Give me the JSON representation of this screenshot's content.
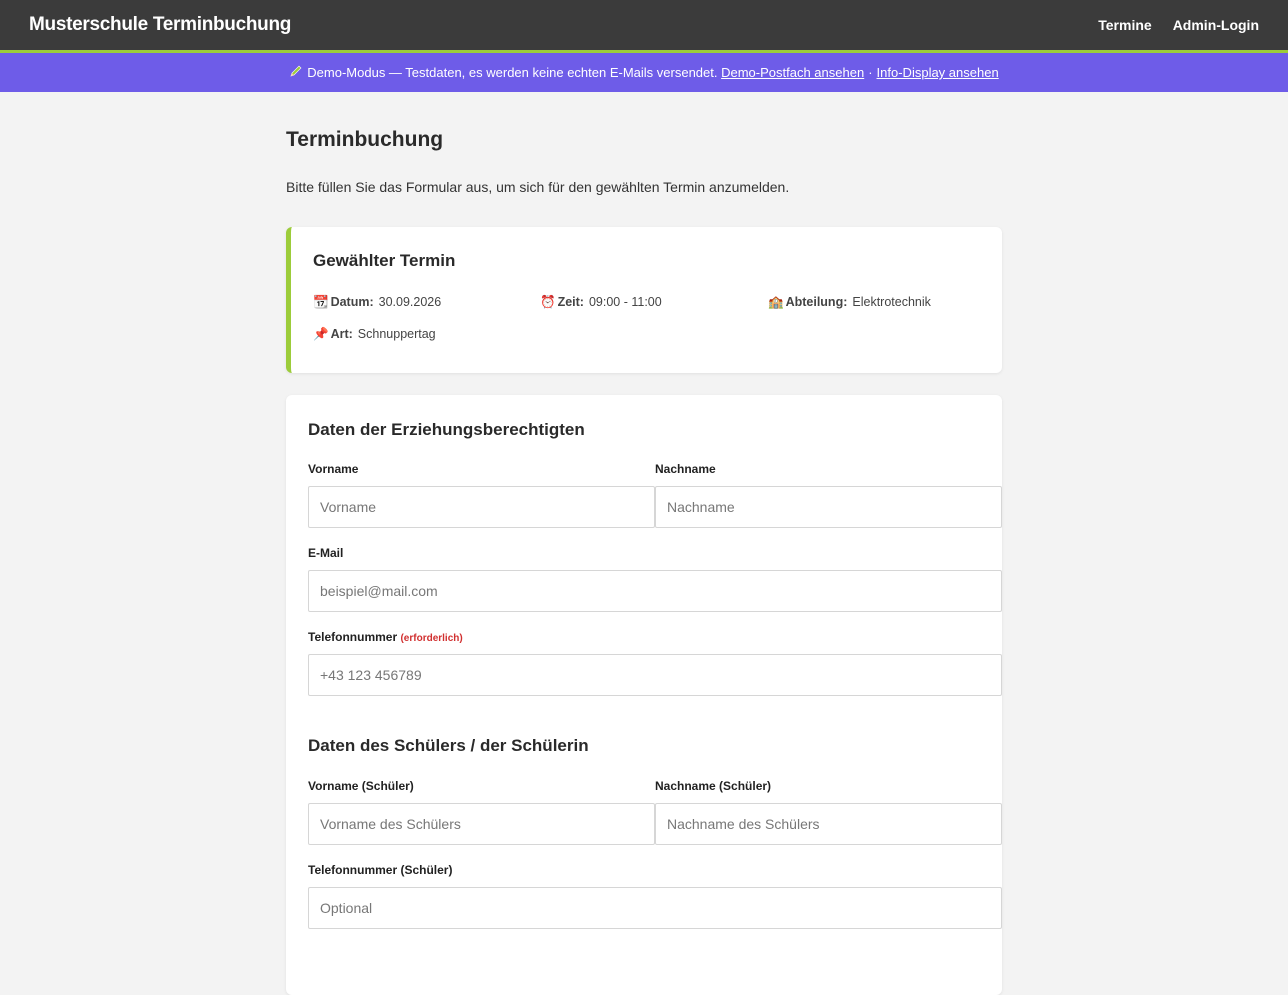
{
  "header": {
    "brand": "Musterschule Terminbuchung",
    "nav": [
      "Termine",
      "Admin-Login"
    ]
  },
  "banner": {
    "icon": "pencil-icon",
    "text": "Demo-Modus — Testdaten, es werden keine echten E-Mails versendet.",
    "link1": "Demo-Postfach ansehen",
    "separator": "·",
    "link2": "Info-Display ansehen"
  },
  "page": {
    "title": "Terminbuchung",
    "intro": "Bitte füllen Sie das Formular aus, um sich für den gewählten Termin anzumelden."
  },
  "termin": {
    "heading": "Gewählter Termin",
    "items": [
      {
        "icon": "📆",
        "label": "Datum:",
        "value": "30.09.2026"
      },
      {
        "icon": "⏰",
        "label": "Zeit:",
        "value": "09:00 - 11:00"
      },
      {
        "icon": "🏫",
        "label": "Abteilung:",
        "value": "Elektrotechnik"
      },
      {
        "icon": "📌",
        "label": "Art:",
        "value": "Schnuppertag"
      }
    ]
  },
  "guardian": {
    "heading": "Daten der Erziehungsberechtigten",
    "firstname": {
      "label": "Vorname",
      "placeholder": "Vorname",
      "value": ""
    },
    "lastname": {
      "label": "Nachname",
      "placeholder": "Nachname",
      "value": ""
    },
    "email": {
      "label": "E-Mail",
      "placeholder": "beispiel@mail.com",
      "value": ""
    },
    "phone": {
      "label": "Telefonnummer",
      "required_note": "(erforderlich)",
      "placeholder": "+43 123 456789",
      "value": ""
    }
  },
  "student": {
    "heading": "Daten des Schülers / der Schülerin",
    "firstname": {
      "label": "Vorname (Schüler)",
      "placeholder": "Vorname des Schülers",
      "value": ""
    },
    "lastname": {
      "label": "Nachname (Schüler)",
      "placeholder": "Nachname des Schülers",
      "value": ""
    },
    "phone": {
      "label": "Telefonnummer (Schüler)",
      "placeholder": "Optional",
      "value": ""
    }
  },
  "colors": {
    "topbar": "#3b3b3b",
    "accent": "#9ccc3a",
    "banner": "#6e5ce8",
    "required": "#d12f2f"
  }
}
